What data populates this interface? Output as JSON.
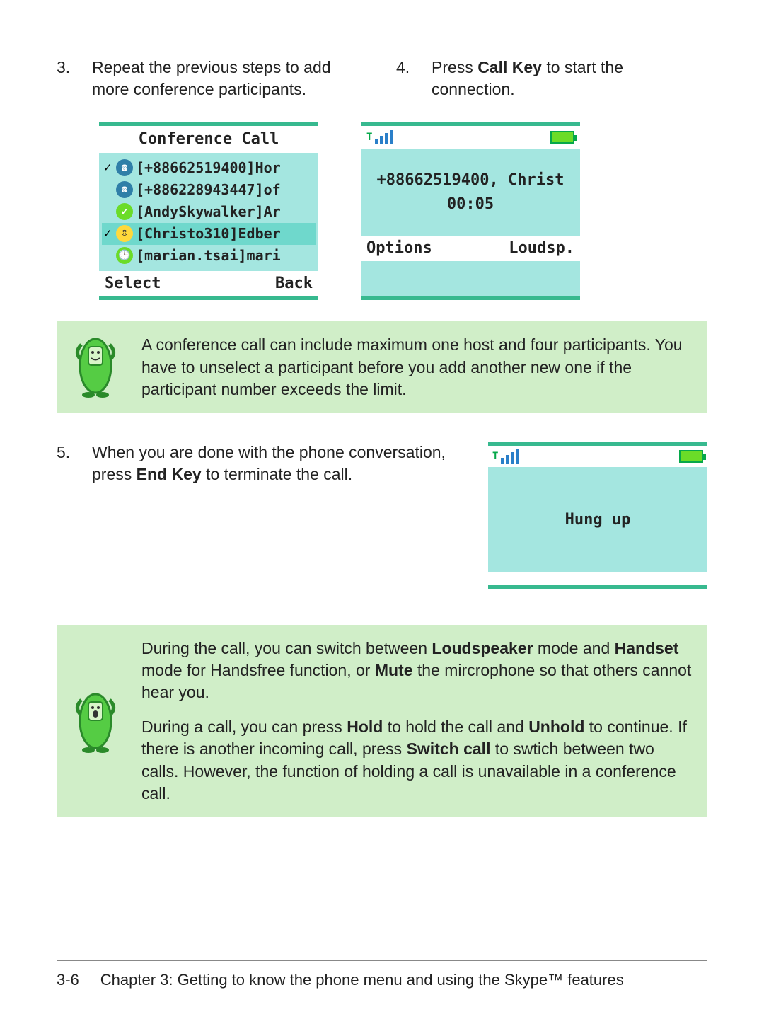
{
  "steps": {
    "s3": {
      "num": "3.",
      "text_a": "Repeat the previous steps to add more conference participants."
    },
    "s4": {
      "num": "4.",
      "text_a": "Press ",
      "bold": "Call Key",
      "text_b": " to start the connection."
    },
    "s5": {
      "num": "5.",
      "text_a": "When you are done with the phone conversation, press ",
      "bold": "End Key",
      "text_b": " to terminate the call."
    }
  },
  "screen_conf": {
    "title": "Conference Call",
    "contacts": [
      {
        "checked": true,
        "icon": "phone-blue",
        "label": "[+88662519400]Hor"
      },
      {
        "checked": false,
        "icon": "phone-blue",
        "label": "[+886228943447]of"
      },
      {
        "checked": false,
        "icon": "status-green",
        "label": "[AndySkywalker]Ar"
      },
      {
        "checked": true,
        "icon": "status-yellow",
        "label": "[Christo310]Edber",
        "selected": true
      },
      {
        "checked": false,
        "icon": "status-away",
        "label": "[marian.tsai]mari"
      }
    ],
    "soft_left": "Select",
    "soft_right": "Back"
  },
  "screen_call": {
    "line1": "+88662519400, Christ",
    "time": "00:05",
    "soft_left": "Options",
    "soft_right": "Loudsp."
  },
  "screen_hung": {
    "text": "Hung up"
  },
  "note1": "A conference call can include maximum one host and four participants. You have to unselect a participant before you add another new one if the participant number exceeds the limit.",
  "note2": {
    "p1_a": "During the call, you can switch between ",
    "b1": "Loudspeaker",
    "p1_b": " mode and ",
    "b2": "Handset",
    "p1_c": " mode for Handsfree function, or ",
    "b3": "Mute",
    "p1_d": " the mircrophone so that others cannot hear you.",
    "p2_a": "During a call, you can press ",
    "b4": "Hold",
    "p2_b": " to hold the call and ",
    "b5": "Unhold",
    "p2_c": " to continue. If there is another incoming call, press ",
    "b6": "Switch call",
    "p2_d": " to swtich between two calls. However, the function of holding a call is unavailable in a conference call."
  },
  "footer": {
    "page": "3-6",
    "chapter": "Chapter 3: Getting to know the phone menu and using the Skype™ features"
  }
}
